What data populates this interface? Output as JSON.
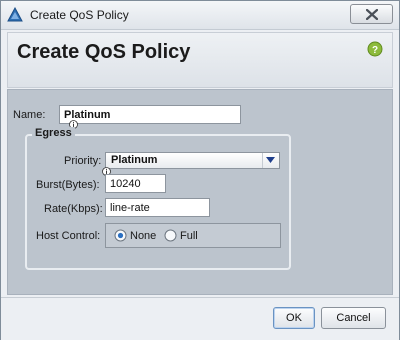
{
  "window": {
    "title": "Create QoS Policy",
    "icon": "app-logo-icon",
    "close_icon": "close-icon"
  },
  "header": {
    "title": "Create QoS Policy",
    "help_icon": "help-icon"
  },
  "form": {
    "name_label": "Name:",
    "name_value": "Platinum",
    "egress": {
      "legend": "Egress",
      "priority_label": "Priority:",
      "priority_value": "Platinum",
      "burst_label": "Burst(Bytes):",
      "burst_value": "10240",
      "rate_label": "Rate(Kbps):",
      "rate_value": "line-rate",
      "host_control_label": "Host Control:",
      "host_control_options": [
        "None",
        "Full"
      ],
      "host_control_selected": "None"
    }
  },
  "footer": {
    "ok_label": "OK",
    "cancel_label": "Cancel"
  },
  "colors": {
    "content_bg": "#bcc4cd",
    "radio_accent": "#2a6fc1"
  }
}
